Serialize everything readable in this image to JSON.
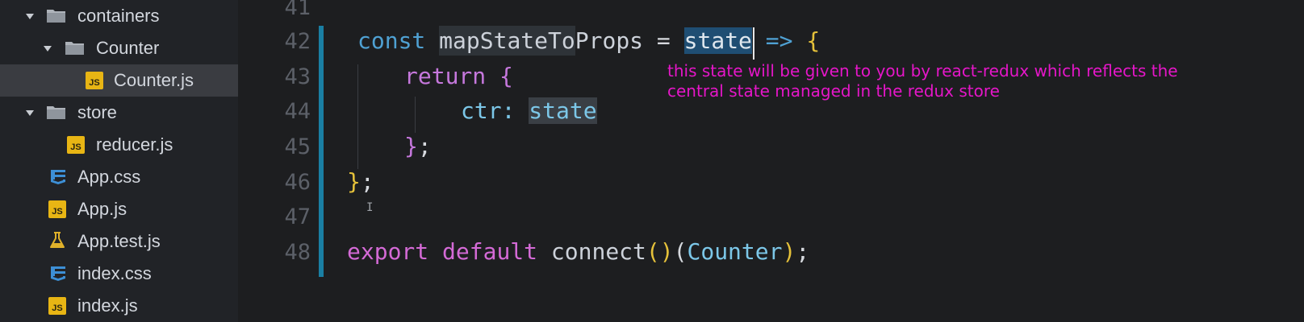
{
  "sidebar": {
    "items": [
      {
        "label": "containers",
        "type": "folder"
      },
      {
        "label": "Counter",
        "type": "folder"
      },
      {
        "label": "Counter.js",
        "type": "js",
        "selected": true
      },
      {
        "label": "store",
        "type": "folder"
      },
      {
        "label": "reducer.js",
        "type": "js"
      },
      {
        "label": "App.css",
        "type": "css"
      },
      {
        "label": "App.js",
        "type": "js"
      },
      {
        "label": "App.test.js",
        "type": "test"
      },
      {
        "label": "index.css",
        "type": "css"
      },
      {
        "label": "index.js",
        "type": "js"
      }
    ],
    "js_icon_text": "JS"
  },
  "editor": {
    "line_numbers": [
      "41",
      "42",
      "43",
      "44",
      "45",
      "46",
      "47",
      "48"
    ],
    "tokens": {
      "l42_const": "const",
      "l42_name": "mapStateToProps",
      "l42_eq": "=",
      "l42_param": "state",
      "l42_arrow": "=>",
      "l42_brace": "{",
      "l43_return": "return",
      "l43_brace": "{",
      "l44_key": "ctr:",
      "l44_val": "state",
      "l45_close": "}",
      "l45_semi": ";",
      "l46_close": "}",
      "l46_semi": ";",
      "l48_export": "export",
      "l48_default": "default",
      "l48_connect": "connect",
      "l48_parens": "()",
      "l48_lparen": "(",
      "l48_counter": "Counter",
      "l48_rparen": ")",
      "l48_semi": ";"
    },
    "annotation": "this state will be given to you by react-redux which reflects the central state managed in the redux store",
    "mouse_cursor_glyph": "I"
  },
  "colors": {
    "keyword": "#4fa1d3",
    "pink_keyword": "#c678dd",
    "bracket": "#e5c13a",
    "annotation": "#e516c8",
    "gutter_marker": "#1a7fa3"
  }
}
